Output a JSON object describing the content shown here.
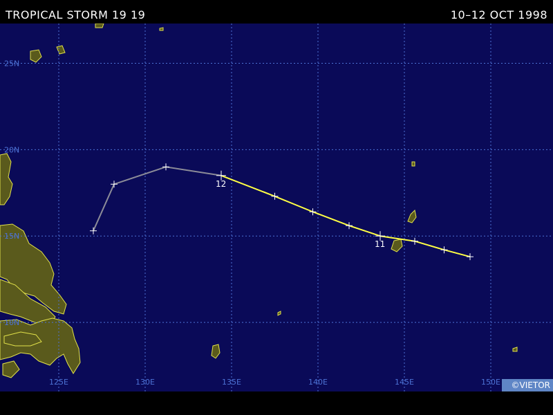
{
  "header": {
    "title": "TROPICAL STORM 19 19",
    "date": "10–12 OCT 1998"
  },
  "credit": "©VIETOR",
  "map": {
    "lon_range": [
      121.6,
      153.6
    ],
    "lat_range": [
      6.0,
      27.3
    ],
    "lat_labels": [
      {
        "lat": 25,
        "text": "25N"
      },
      {
        "lat": 20,
        "text": "20N"
      },
      {
        "lat": 15,
        "text": "15N"
      },
      {
        "lat": 10,
        "text": "10N"
      }
    ],
    "lon_labels": [
      {
        "lon": 125,
        "text": "125E"
      },
      {
        "lon": 130,
        "text": "130E"
      },
      {
        "lon": 135,
        "text": "135E"
      },
      {
        "lon": 140,
        "text": "140E"
      },
      {
        "lon": 145,
        "text": "145E"
      },
      {
        "lon": 150,
        "text": "150E"
      }
    ],
    "colors": {
      "ocean": "#0a0a58",
      "land": "#5a5a1c",
      "coast": "#e2e24a",
      "grid": "#4d73d6",
      "track_storm": "#ffff44",
      "track_weak": "#8c8c98",
      "tick": "#ffffff"
    },
    "track": [
      {
        "lon": 148.8,
        "lat": 13.8,
        "intensity": "storm"
      },
      {
        "lon": 147.3,
        "lat": 14.2,
        "intensity": "storm"
      },
      {
        "lon": 145.6,
        "lat": 14.7,
        "intensity": "storm"
      },
      {
        "lon": 143.6,
        "lat": 15.0,
        "intensity": "storm",
        "day_label": "11"
      },
      {
        "lon": 141.8,
        "lat": 15.6,
        "intensity": "storm"
      },
      {
        "lon": 139.7,
        "lat": 16.4,
        "intensity": "storm"
      },
      {
        "lon": 137.5,
        "lat": 17.3,
        "intensity": "storm"
      },
      {
        "lon": 134.4,
        "lat": 18.5,
        "intensity": "storm",
        "day_label": "12"
      },
      {
        "lon": 131.2,
        "lat": 19.0,
        "intensity": "weak"
      },
      {
        "lon": 128.2,
        "lat": 18.0,
        "intensity": "weak"
      },
      {
        "lon": 127.0,
        "lat": 15.3,
        "intensity": "weak"
      }
    ]
  }
}
